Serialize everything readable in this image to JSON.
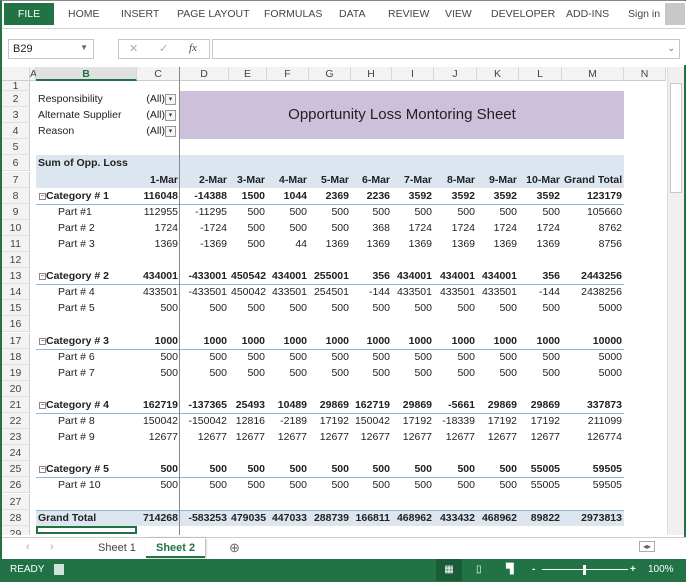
{
  "ribbon": {
    "tabs": [
      "FILE",
      "HOME",
      "INSERT",
      "PAGE LAYOUT",
      "FORMULAS",
      "DATA",
      "REVIEW",
      "VIEW",
      "DEVELOPER",
      "ADD-INS"
    ],
    "sign_in": "Sign in"
  },
  "formula_bar": {
    "name_box": "B29",
    "fx": "fx",
    "value": ""
  },
  "columns": [
    "A",
    "B",
    "C",
    "D",
    "E",
    "F",
    "G",
    "H",
    "I",
    "J",
    "K",
    "L",
    "M",
    "N"
  ],
  "selected_column": "B",
  "filters": [
    {
      "row": "2",
      "label": "Responsibility",
      "value": "(All)"
    },
    {
      "row": "3",
      "label": "Alternate Supplier",
      "value": "(All)"
    },
    {
      "row": "4",
      "label": "Reason",
      "value": "(All)"
    }
  ],
  "title": "Opportunity Loss Montoring Sheet",
  "pivot": {
    "value_label": "Sum of Opp. Loss",
    "headers": [
      "1-Mar",
      "2-Mar",
      "3-Mar",
      "4-Mar",
      "5-Mar",
      "6-Mar",
      "7-Mar",
      "8-Mar",
      "9-Mar",
      "10-Mar",
      "Grand Total"
    ],
    "rows": [
      {
        "row": "8",
        "type": "cat",
        "label": "Category # 1",
        "values": [
          "116048",
          "-14388",
          "1500",
          "1044",
          "2369",
          "2236",
          "3592",
          "3592",
          "3592",
          "3592",
          "123179"
        ]
      },
      {
        "row": "9",
        "type": "part",
        "label": "Part #1",
        "values": [
          "112955",
          "-11295",
          "500",
          "500",
          "500",
          "500",
          "500",
          "500",
          "500",
          "500",
          "105660"
        ]
      },
      {
        "row": "10",
        "type": "part",
        "label": "Part # 2",
        "values": [
          "1724",
          "-1724",
          "500",
          "500",
          "500",
          "368",
          "1724",
          "1724",
          "1724",
          "1724",
          "8762"
        ]
      },
      {
        "row": "11",
        "type": "part",
        "label": "Part # 3",
        "values": [
          "1369",
          "-1369",
          "500",
          "44",
          "1369",
          "1369",
          "1369",
          "1369",
          "1369",
          "1369",
          "8756"
        ]
      },
      {
        "row": "12",
        "type": "blank"
      },
      {
        "row": "13",
        "type": "cat",
        "label": "Category # 2",
        "values": [
          "434001",
          "-433001",
          "450542",
          "434001",
          "255001",
          "356",
          "434001",
          "434001",
          "434001",
          "356",
          "2443256"
        ]
      },
      {
        "row": "14",
        "type": "part",
        "label": "Part # 4",
        "values": [
          "433501",
          "-433501",
          "450042",
          "433501",
          "254501",
          "-144",
          "433501",
          "433501",
          "433501",
          "-144",
          "2438256"
        ]
      },
      {
        "row": "15",
        "type": "part",
        "label": "Part # 5",
        "values": [
          "500",
          "500",
          "500",
          "500",
          "500",
          "500",
          "500",
          "500",
          "500",
          "500",
          "5000"
        ]
      },
      {
        "row": "16",
        "type": "blank"
      },
      {
        "row": "17",
        "type": "cat",
        "label": "Category # 3",
        "values": [
          "1000",
          "1000",
          "1000",
          "1000",
          "1000",
          "1000",
          "1000",
          "1000",
          "1000",
          "1000",
          "10000"
        ]
      },
      {
        "row": "18",
        "type": "part",
        "label": "Part # 6",
        "values": [
          "500",
          "500",
          "500",
          "500",
          "500",
          "500",
          "500",
          "500",
          "500",
          "500",
          "5000"
        ]
      },
      {
        "row": "19",
        "type": "part",
        "label": "Part # 7",
        "values": [
          "500",
          "500",
          "500",
          "500",
          "500",
          "500",
          "500",
          "500",
          "500",
          "500",
          "5000"
        ]
      },
      {
        "row": "20",
        "type": "blank"
      },
      {
        "row": "21",
        "type": "cat",
        "label": "Category # 4",
        "values": [
          "162719",
          "-137365",
          "25493",
          "10489",
          "29869",
          "162719",
          "29869",
          "-5661",
          "29869",
          "29869",
          "337873"
        ]
      },
      {
        "row": "22",
        "type": "part",
        "label": "Part # 8",
        "values": [
          "150042",
          "-150042",
          "12816",
          "-2189",
          "17192",
          "150042",
          "17192",
          "-18339",
          "17192",
          "17192",
          "211099"
        ]
      },
      {
        "row": "23",
        "type": "part",
        "label": "Part # 9",
        "values": [
          "12677",
          "12677",
          "12677",
          "12677",
          "12677",
          "12677",
          "12677",
          "12677",
          "12677",
          "12677",
          "126774"
        ]
      },
      {
        "row": "24",
        "type": "blank"
      },
      {
        "row": "25",
        "type": "cat",
        "label": "Category # 5",
        "values": [
          "500",
          "500",
          "500",
          "500",
          "500",
          "500",
          "500",
          "500",
          "500",
          "55005",
          "59505"
        ]
      },
      {
        "row": "26",
        "type": "part",
        "label": "Part # 10",
        "values": [
          "500",
          "500",
          "500",
          "500",
          "500",
          "500",
          "500",
          "500",
          "500",
          "55005",
          "59505"
        ]
      },
      {
        "row": "27",
        "type": "blank"
      },
      {
        "row": "28",
        "type": "total",
        "label": "Grand Total",
        "values": [
          "714268",
          "-583253",
          "479035",
          "447033",
          "288739",
          "166811",
          "468962",
          "433432",
          "468962",
          "89822",
          "2973813"
        ]
      }
    ]
  },
  "sheets": [
    "Sheet 1",
    "Sheet 2"
  ],
  "active_sheet": "Sheet 2",
  "status": {
    "ready": "READY",
    "zoom": "100%",
    "zoom_level_percent": 100
  },
  "colors": {
    "accent": "#217346",
    "pivot_header": "#dce6f1",
    "title_fill": "#ccc0da"
  }
}
